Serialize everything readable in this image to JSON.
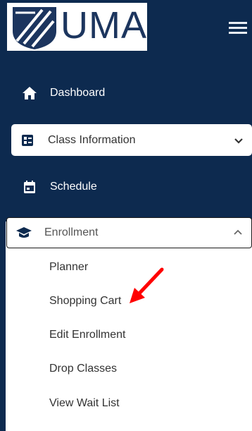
{
  "logo": {
    "text": "UMA"
  },
  "nav": {
    "dashboard": "Dashboard",
    "class_information": "Class Information",
    "schedule": "Schedule",
    "enrollment": "Enrollment"
  },
  "enrollment_submenu": [
    "Planner",
    "Shopping Cart",
    "Edit Enrollment",
    "Drop Classes",
    "View Wait List"
  ],
  "icons": {
    "menu": "hamburger-menu-icon",
    "dashboard": "home-icon",
    "class_information": "id-card-icon",
    "schedule": "calendar-icon",
    "enrollment": "graduation-cap-icon",
    "expand": "chevron-down-icon",
    "collapse": "chevron-up-icon",
    "annotation": "red-arrow-icon"
  },
  "colors": {
    "sidebar": "#0d2a4f",
    "active_bg": "#ffffff",
    "annotation": "#ff0000"
  }
}
